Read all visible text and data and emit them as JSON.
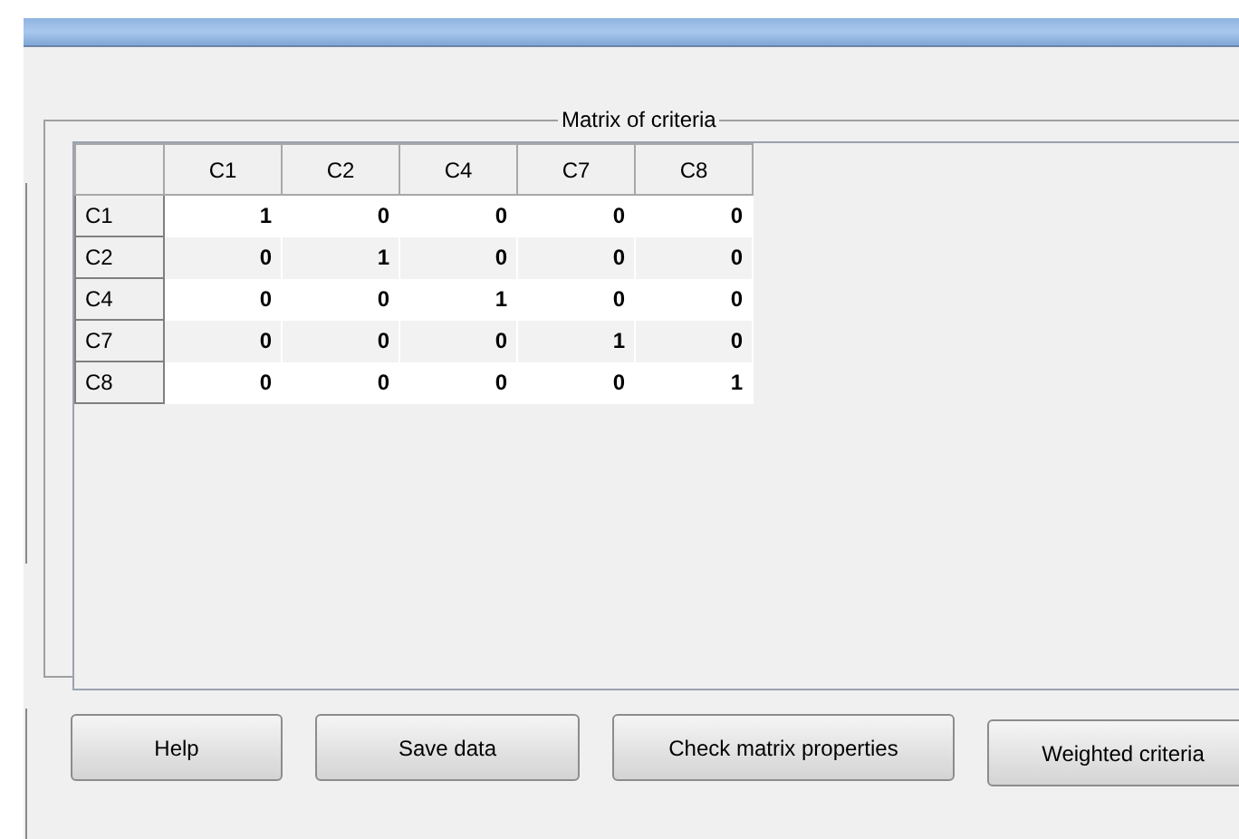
{
  "group_title": "Matrix of criteria",
  "table": {
    "columns": [
      "C1",
      "C2",
      "C4",
      "C7",
      "C8"
    ],
    "rows": [
      {
        "header": "C1",
        "cells": [
          "1",
          "0",
          "0",
          "0",
          "0"
        ]
      },
      {
        "header": "C2",
        "cells": [
          "0",
          "1",
          "0",
          "0",
          "0"
        ]
      },
      {
        "header": "C4",
        "cells": [
          "0",
          "0",
          "1",
          "0",
          "0"
        ]
      },
      {
        "header": "C7",
        "cells": [
          "0",
          "0",
          "0",
          "1",
          "0"
        ]
      },
      {
        "header": "C8",
        "cells": [
          "0",
          "0",
          "0",
          "0",
          "1"
        ]
      }
    ]
  },
  "buttons": [
    "Help",
    "Save data",
    "Check matrix properties",
    "Weighted criteria"
  ]
}
